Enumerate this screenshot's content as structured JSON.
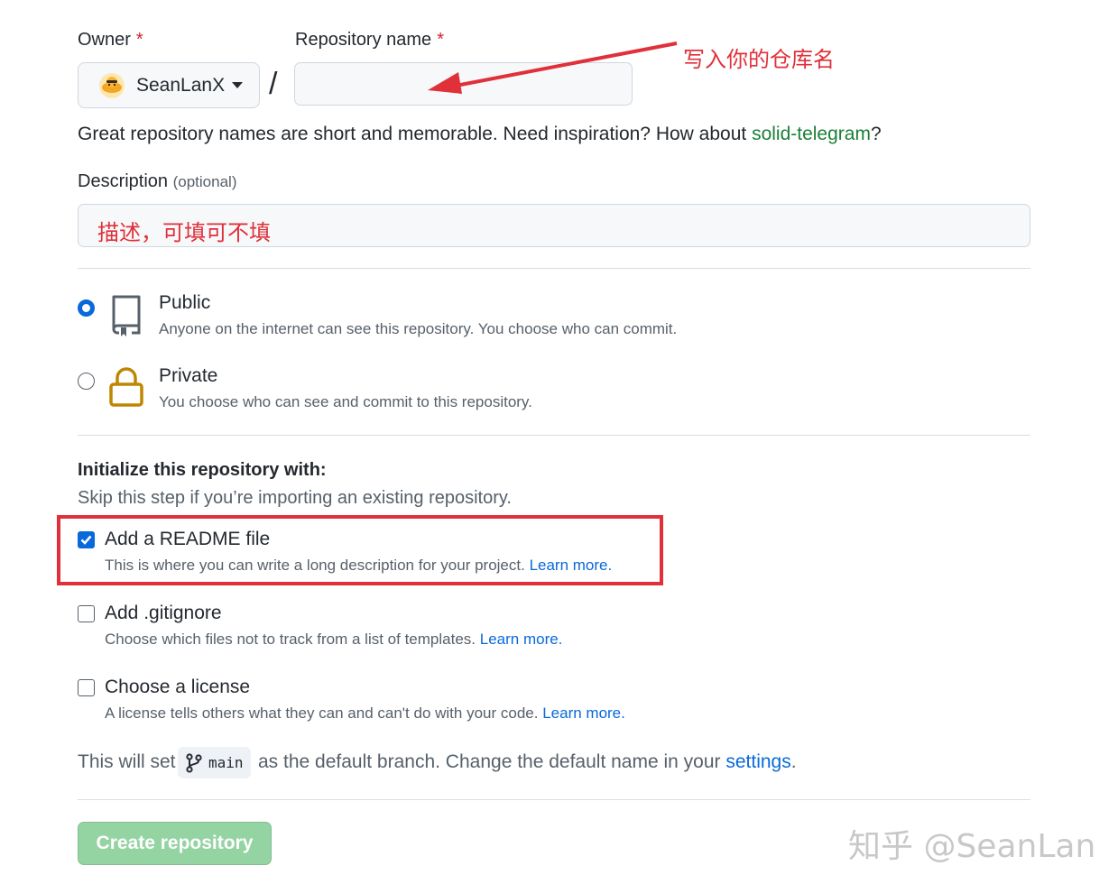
{
  "owner": {
    "label": "Owner",
    "required_mark": "*",
    "username": "SeanLanX"
  },
  "repo_name": {
    "label": "Repository name",
    "required_mark": "*",
    "value": "",
    "separator": "/"
  },
  "hint": {
    "text_before": "Great repository names are short and memorable. Need inspiration? How about ",
    "suggestion": "solid-telegram",
    "text_after": "?"
  },
  "description": {
    "label": "Description",
    "optional": "(optional)"
  },
  "visibility": {
    "public": {
      "title": "Public",
      "desc": "Anyone on the internet can see this repository. You choose who can commit.",
      "selected": true
    },
    "private": {
      "title": "Private",
      "desc": "You choose who can see and commit to this repository.",
      "selected": false
    }
  },
  "init": {
    "heading": "Initialize this repository with:",
    "subheading": "Skip this step if you’re importing an existing repository.",
    "readme": {
      "title": "Add a README file",
      "desc": "This is where you can write a long description for your project.",
      "link": "Learn more.",
      "checked": true
    },
    "gitignore": {
      "title": "Add .gitignore",
      "desc": "Choose which files not to track from a list of templates.",
      "link": "Learn more.",
      "checked": false
    },
    "license": {
      "title": "Choose a license",
      "desc": "A license tells others what they can and can't do with your code.",
      "link": "Learn more.",
      "checked": false
    }
  },
  "branch": {
    "before": "This will set",
    "name": "main",
    "after": "as the default branch. Change the default name in your",
    "link": "settings",
    "end": "."
  },
  "create_button": "Create repository",
  "annotations": {
    "repo_name_note": "写入你的仓库名",
    "description_note": "描述，可填可不填"
  },
  "watermark": "知乎 @SeanLan",
  "colors": {
    "accent_blue": "#0969da",
    "link_green": "#1a7f37",
    "annotation_red": "#e0303a",
    "button_green_disabled": "#94d3a2",
    "lock_gold": "#bf8700"
  },
  "icons": {
    "avatar": "avatar-icon",
    "public": "repo-book-icon",
    "private": "lock-icon",
    "branch": "git-branch-icon",
    "checkmark": "check-icon"
  }
}
